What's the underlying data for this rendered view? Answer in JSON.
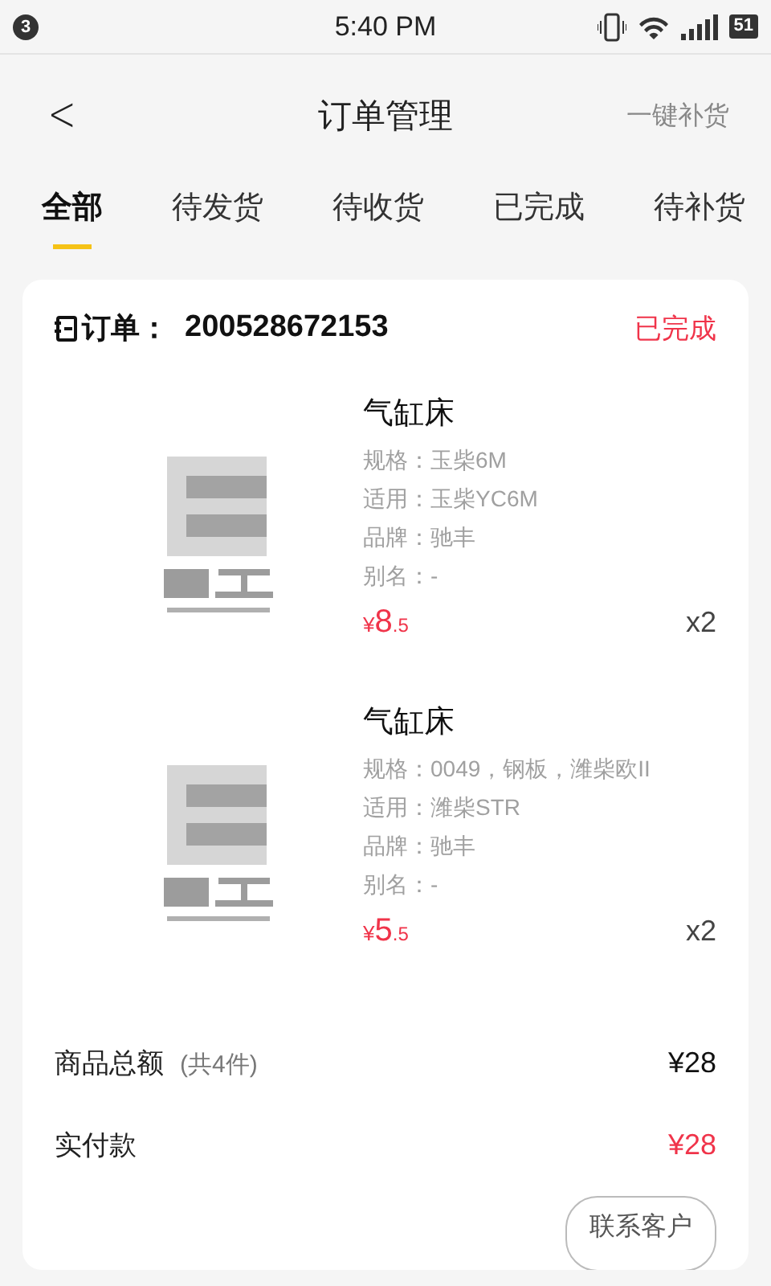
{
  "status_bar": {
    "notification_count": "3",
    "time": "5:40 PM",
    "battery": "51"
  },
  "header": {
    "back": "<",
    "title": "订单管理",
    "action": "一键补货"
  },
  "tabs": [
    {
      "label": "全部",
      "selected": true
    },
    {
      "label": "待发货",
      "selected": false
    },
    {
      "label": "待收货",
      "selected": false
    },
    {
      "label": "已完成",
      "selected": false
    },
    {
      "label": "待补货",
      "selected": false
    }
  ],
  "order": {
    "label": "订单：",
    "number": "200528672153",
    "status": "已完成",
    "items": [
      {
        "kind": "picture",
        "name": "气缸床",
        "specs": [
          "规格：玉柴6M",
          "适用：玉柴YC6M",
          "品牌：驰丰",
          "别名：-"
        ],
        "price_symbol": "¥",
        "price_integer": "8",
        "price_decimal": ".5",
        "quantity": "x2"
      },
      {
        "kind": "picture",
        "name": "气缸床",
        "specs": [
          "规格：0049，钢板，潍柴欧II",
          "适用：潍柴STR",
          "品牌：驰丰",
          "别名：-"
        ],
        "price_symbol": "¥",
        "price_integer": "5",
        "price_decimal": ".5",
        "quantity": "x2"
      }
    ],
    "total_label": "商品总额",
    "total_count": "(共4件)",
    "total_amount": "¥28",
    "paid_label": "实付款",
    "paid_amount": "¥28",
    "button": "联系客户"
  }
}
